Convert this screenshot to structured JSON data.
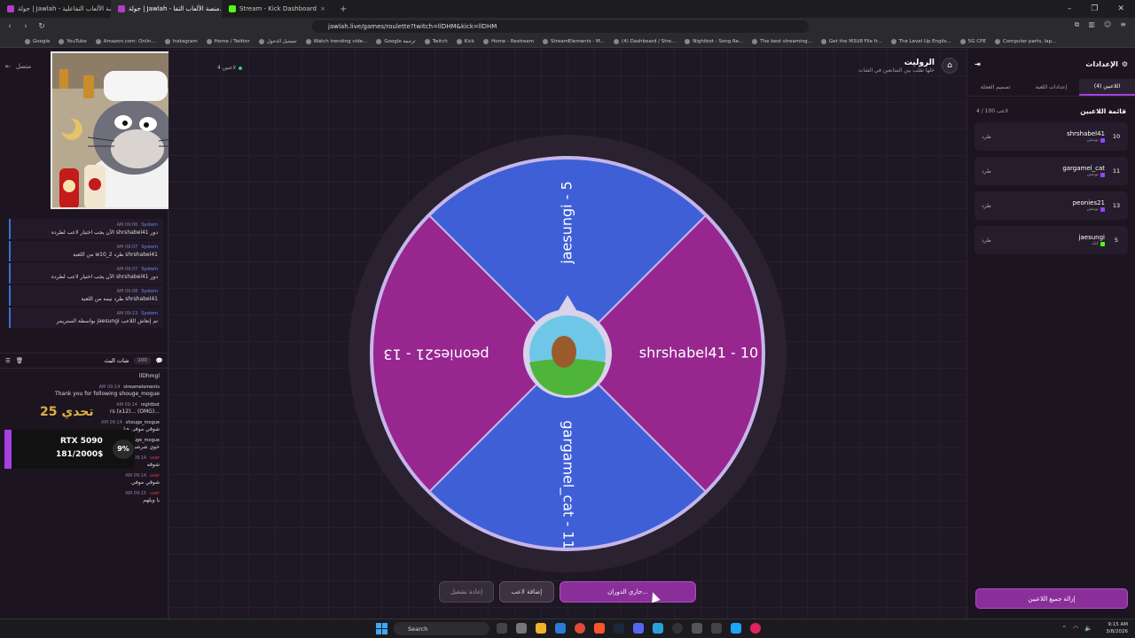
{
  "browser": {
    "tabs": [
      {
        "label": "جولة | Jawlah - منصة الألعاب التفاعلية",
        "active": false
      },
      {
        "label": "جولة | Jawlah - منصة الألعاب التفا...",
        "active": true
      },
      {
        "label": "Stream - Kick Dashboard",
        "active": false
      }
    ],
    "new_tab": "+",
    "url": "jawlah.live/games/roulette?twitch=llDHM&kick=llDHM",
    "bookmarks": [
      "Google",
      "YouTube",
      "Amazon.com: Onlin...",
      "Instagram",
      "Home / Twitter",
      "تسجيل الدخول",
      "Watch trending vide...",
      "Google ترجمة",
      "Twitch",
      "Kick",
      "Home - Restream",
      "StreamElements - M...",
      "(4) Dashboard / Stre...",
      "Nightbot - Song Re...",
      "The best streaming...",
      "Get the M3U8 File fr...",
      "The Level Up Englis...",
      "5G CPE",
      "Computer parts, lap..."
    ]
  },
  "left": {
    "connect_label": "متصل",
    "system_messages": [
      {
        "time": "AM 09:06",
        "who": "System",
        "text": "دور shrshabel41 الآن يجب اختيار لاعب لطرده"
      },
      {
        "time": "AM 09:07",
        "who": "System",
        "text": "shrshabel41 طرد w10_2 من اللعبة"
      },
      {
        "time": "AM 09:07",
        "who": "System",
        "text": "دور shrshabel41 الآن يجب اختيار لاعب لطرده"
      },
      {
        "time": "AM 09:08",
        "who": "System",
        "text": "shrshabel41 طرد نيمه من اللعبة"
      },
      {
        "time": "AM 09:13",
        "who": "System",
        "text": "تم إنعاش اللاعب jaesungi بواسطة الستريمر"
      }
    ],
    "chat_title": "شات البث",
    "chat_count": "100",
    "chat_messages": [
      {
        "time": "",
        "who": "",
        "text": "llDhmgl",
        "red": false
      },
      {
        "time": "AM 09:14",
        "who": "streamelements",
        "text": "Thank you for following shouge_mogue",
        "red": false
      },
      {
        "time": "AM 09:14",
        "who": "nightbot",
        "text": "...(OMG) ...rs (x12)",
        "red": false
      },
      {
        "time": "AM 09:14",
        "who": "shouge_mogue",
        "text": "شوقي موفي هنا",
        "red": false
      },
      {
        "time": "AM 09:14",
        "who": "shouge_mogue",
        "text": "خوي شرشبيل",
        "red": false
      },
      {
        "time": "AM 09:14",
        "who": "user",
        "text": "شوقه",
        "red": true
      },
      {
        "time": "AM 09:14",
        "who": "user",
        "text": "شوقي موفي",
        "red": true
      },
      {
        "time": "AM 09:15",
        "who": "user",
        "text": "يا ويلهم",
        "red": true
      }
    ],
    "overlay_text": "25 تحدي",
    "goal": {
      "title": "RTX 5090",
      "progress_text": "181/2000$",
      "percent": "9%"
    }
  },
  "center": {
    "title": "الروليت",
    "subtitle": "خلها تقلب بين المتابعين في الشات",
    "players_online": "4 لاعبين",
    "wheel": {
      "segments": [
        {
          "label": "shrshabel41 - 10",
          "color": "#98268f"
        },
        {
          "label": "gargamel_cat - 11",
          "color": "#3f5fd6"
        },
        {
          "label": "peonies21 - 13",
          "color": "#98268f"
        },
        {
          "label": "jaesungi - 5",
          "color": "#3f5fd6"
        }
      ],
      "rim_color": "#c5b6ea"
    },
    "buttons": {
      "restart": "إعادة تشغيل",
      "add_player": "إضافة لاعب",
      "spinning": "جاري الدوران..."
    }
  },
  "right": {
    "title": "الإعدادات",
    "tabs": [
      "اللاعبين (4)",
      "إعدادات اللعبة",
      "تصميم العجلة"
    ],
    "players_title": "قائمة اللاعبين",
    "players_count": "4 / 100 لاعب",
    "kick_label": "طرد",
    "players": [
      {
        "name": "shrshabel41",
        "platform": "تويتش",
        "number": "10",
        "kick": false
      },
      {
        "name": "gargamel_cat",
        "platform": "تويتش",
        "number": "11",
        "kick": false
      },
      {
        "name": "peonies21",
        "platform": "تويتش",
        "number": "13",
        "kick": false
      },
      {
        "name": "jaesungi",
        "platform": "كيك",
        "number": "5",
        "kick": true
      }
    ],
    "remove_all": "إزالة جميع اللاعبين"
  },
  "taskbar": {
    "search_placeholder": "Search",
    "time": "9:15 AM",
    "date": "3/8/2026"
  }
}
